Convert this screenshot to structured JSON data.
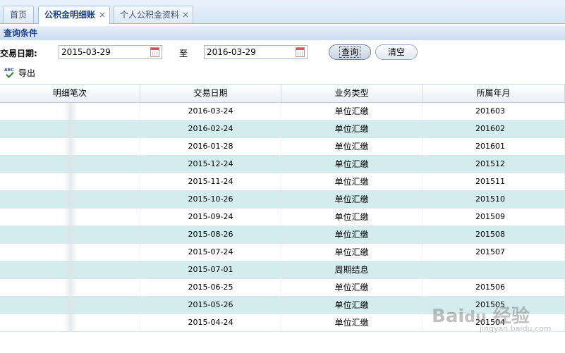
{
  "tabs": [
    {
      "label": "首页",
      "active": false,
      "closable": false
    },
    {
      "label": "公积金明细账",
      "active": true,
      "closable": true
    },
    {
      "label": "个人公积金资料",
      "active": false,
      "closable": true
    }
  ],
  "close_glyph": "×",
  "query": {
    "header": "查询条件",
    "date_label": "交易日期:",
    "date_from": "2015-03-29",
    "to_label": "至",
    "date_to": "2016-03-29",
    "search_button": "查询",
    "clear_button": "清空"
  },
  "toolbar": {
    "export_label": "导出",
    "export_icon_text": "ABC",
    "export_icon": "spellcheck-icon"
  },
  "grid": {
    "columns": [
      "明细笔次",
      "交易日期",
      "业务类型",
      "所属年月"
    ],
    "rows": [
      {
        "seq": "",
        "date": "2016-03-24",
        "type": "单位汇缴",
        "month": "201603"
      },
      {
        "seq": "",
        "date": "2016-02-24",
        "type": "单位汇缴",
        "month": "201602"
      },
      {
        "seq": "",
        "date": "2016-01-28",
        "type": "单位汇缴",
        "month": "201601"
      },
      {
        "seq": "",
        "date": "2015-12-24",
        "type": "单位汇缴",
        "month": "201512"
      },
      {
        "seq": "",
        "date": "2015-11-24",
        "type": "单位汇缴",
        "month": "201511"
      },
      {
        "seq": "",
        "date": "2015-10-26",
        "type": "单位汇缴",
        "month": "201510"
      },
      {
        "seq": "",
        "date": "2015-09-24",
        "type": "单位汇缴",
        "month": "201509"
      },
      {
        "seq": "",
        "date": "2015-08-26",
        "type": "单位汇缴",
        "month": "201508"
      },
      {
        "seq": "",
        "date": "2015-07-24",
        "type": "单位汇缴",
        "month": "201507"
      },
      {
        "seq": "",
        "date": "2015-07-01",
        "type": "周期结息",
        "month": ""
      },
      {
        "seq": "",
        "date": "2015-06-25",
        "type": "单位汇缴",
        "month": "201506"
      },
      {
        "seq": "",
        "date": "2015-05-26",
        "type": "单位汇缴",
        "month": "201505"
      },
      {
        "seq": "",
        "date": "2015-04-24",
        "type": "单位汇缴",
        "month": "201504"
      }
    ]
  },
  "colors": {
    "alt_row": "#d3ecee",
    "header_text": "#15428b",
    "tab_border": "#99bbe8"
  }
}
